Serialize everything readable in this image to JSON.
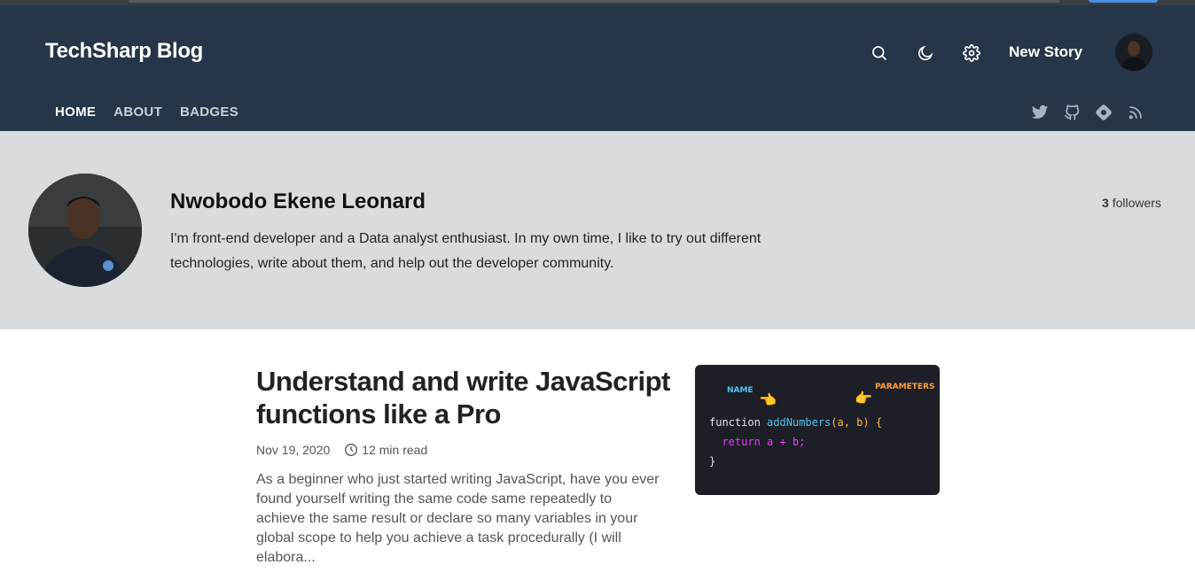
{
  "header": {
    "brand": "TechSharp Blog",
    "new_story": "New Story",
    "icons": [
      "search-icon",
      "moon-icon",
      "gear-icon"
    ]
  },
  "nav": {
    "items": [
      {
        "label": "HOME",
        "active": true
      },
      {
        "label": "ABOUT",
        "active": false
      },
      {
        "label": "BADGES",
        "active": false
      }
    ]
  },
  "social": [
    "twitter-icon",
    "github-icon",
    "hashnode-icon",
    "rss-icon"
  ],
  "profile": {
    "name": "Nwobodo Ekene Leonard",
    "bio": "I'm front-end developer and a Data analyst enthusiast. In my own time, I like to try out different technologies, write about them, and help out the developer community.",
    "followers_count": "3",
    "followers_label": "followers"
  },
  "post": {
    "title": "Understand and write JavaScript functions like a Pro",
    "date": "Nov 19, 2020",
    "read_time": "12 min read",
    "excerpt": "As a beginner who just started writing JavaScript, have you ever found yourself writing the same code same repeatedly to achieve the same result or declare so many variables in your global scope to help you achieve a task procedurally (I will elabora...",
    "thumb": {
      "label_name": "NAME",
      "label_params": "PARAMETERS",
      "code_kw": "function",
      "code_fname": "addNumbers",
      "code_params": "(a, b) {",
      "code_return": "return a + b;",
      "code_close": "}"
    }
  },
  "colors": {
    "header_bg": "#263548",
    "profile_bg": "#d9dcdf",
    "thumb_bg": "#1e1f26"
  }
}
